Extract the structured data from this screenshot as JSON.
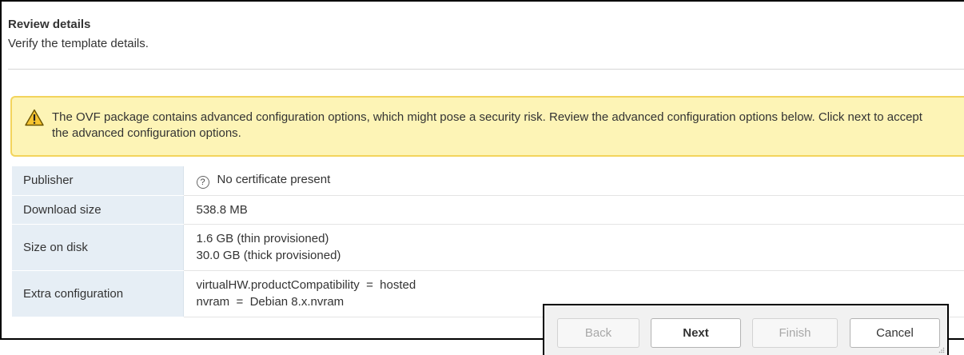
{
  "header": {
    "title": "Review details",
    "subtitle": "Verify the template details."
  },
  "warning": {
    "icon": "warning-triangle-icon",
    "text": "The OVF package contains advanced configuration options, which might pose a security risk. Review the advanced configuration options below. Click next to accept the advanced configuration options."
  },
  "details": {
    "publisher": {
      "label": "Publisher",
      "icon": "help-circle-icon",
      "value": "No certificate present"
    },
    "download_size": {
      "label": "Download size",
      "value": "538.8 MB"
    },
    "size_on_disk": {
      "label": "Size on disk",
      "values": [
        "1.6 GB (thin provisioned)",
        "30.0 GB (thick provisioned)"
      ]
    },
    "extra_configuration": {
      "label": "Extra configuration",
      "values": [
        "virtualHW.productCompatibility  =  hosted",
        "nvram  =  Debian 8.x.nvram"
      ]
    }
  },
  "buttons": {
    "back": "Back",
    "next": "Next",
    "finish": "Finish",
    "cancel": "Cancel"
  },
  "colors": {
    "warning_background": "#fdf4b6",
    "warning_border": "#f3d45c",
    "label_cell_background": "#e6eef5"
  }
}
